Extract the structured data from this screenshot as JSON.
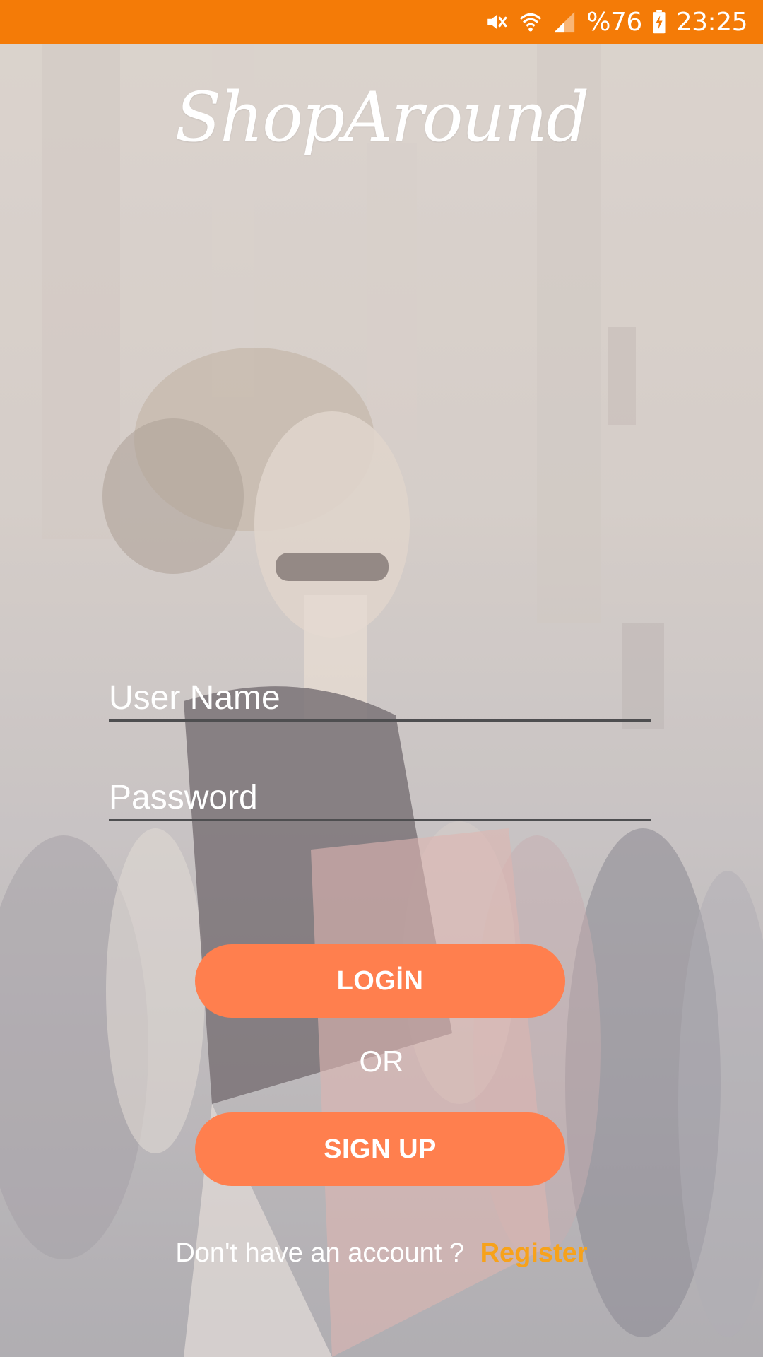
{
  "status_bar": {
    "battery_percent": "%76",
    "time": "23:25",
    "icons": [
      "mute-icon",
      "wifi-icon",
      "cell-signal-icon",
      "battery-charging-icon"
    ],
    "background_color": "#f47b07"
  },
  "app": {
    "logo_text": "ShopAround"
  },
  "form": {
    "username_placeholder": "User Name",
    "username_value": "",
    "password_placeholder": "Password",
    "password_value": ""
  },
  "actions": {
    "login_label": "LOGİN",
    "or_label": "OR",
    "signup_label": "SIGN UP",
    "button_color": "#ff7f4e"
  },
  "footer": {
    "prompt": "Don't have an account ?",
    "register_label": "Register",
    "register_color": "#f7a21b"
  }
}
